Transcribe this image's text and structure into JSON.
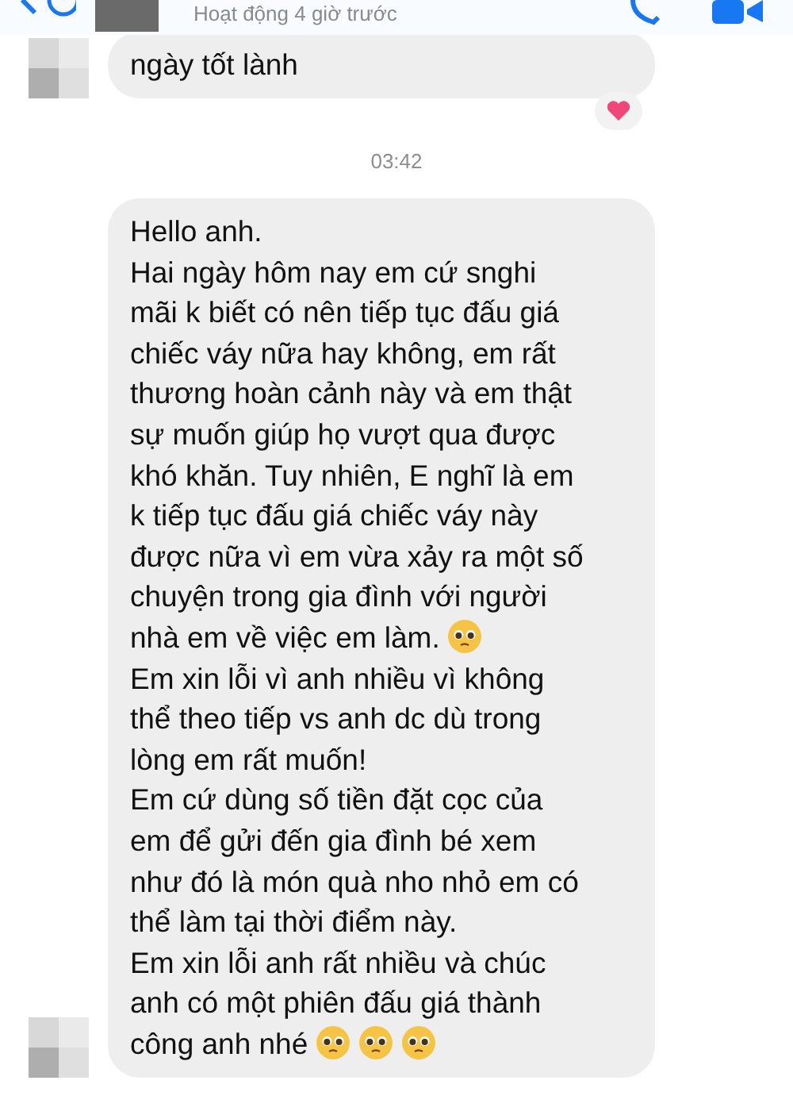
{
  "header": {
    "status": "Hoạt động 4 giờ trước"
  },
  "messages": [
    {
      "kind": "bubble",
      "reaction": {
        "kind": "heart"
      },
      "paragraphs": [
        {
          "lines": [
            "ngày tốt lành"
          ]
        }
      ]
    },
    {
      "kind": "time",
      "text": "03:42"
    },
    {
      "kind": "bubble",
      "paragraphs": [
        {
          "lines": [
            "Hello anh."
          ]
        },
        {
          "lines": [
            "Hai ngày hôm nay em cứ snghi",
            "mãi k biết có nên tiếp tục đấu giá",
            "chiếc váy nữa hay không, em rất",
            "thương hoàn cảnh này và em thật",
            "sự muốn giúp họ vượt qua được",
            "khó khăn. Tuy nhiên, E nghĩ là em",
            "k tiếp tục đấu giá chiếc váy này",
            "được nữa vì em vừa xảy ra một số",
            "chuyện trong gia đình với người",
            "nhà em về việc em làm."
          ],
          "emojis": [
            {
              "kind": "pleading"
            }
          ]
        },
        {
          "lines": [
            "Em xin lỗi vì anh nhiều vì không",
            "thể theo tiếp vs anh dc dù trong",
            "lòng em rất muốn!"
          ]
        },
        {
          "lines": [
            "Em cứ dùng số tiền đặt cọc của",
            "em để gửi đến gia đình bé xem",
            "như đó là món quà nho nhỏ em có",
            "thể làm tại thời điểm này."
          ]
        },
        {
          "lines": [
            "Em xin lỗi anh rất nhiều và chúc",
            "anh có một phiên đấu giá thành",
            "công anh nhé"
          ],
          "emojis": [
            {
              "kind": "pleading"
            },
            {
              "kind": "pleading"
            },
            {
              "kind": "pleading"
            }
          ]
        }
      ]
    }
  ]
}
